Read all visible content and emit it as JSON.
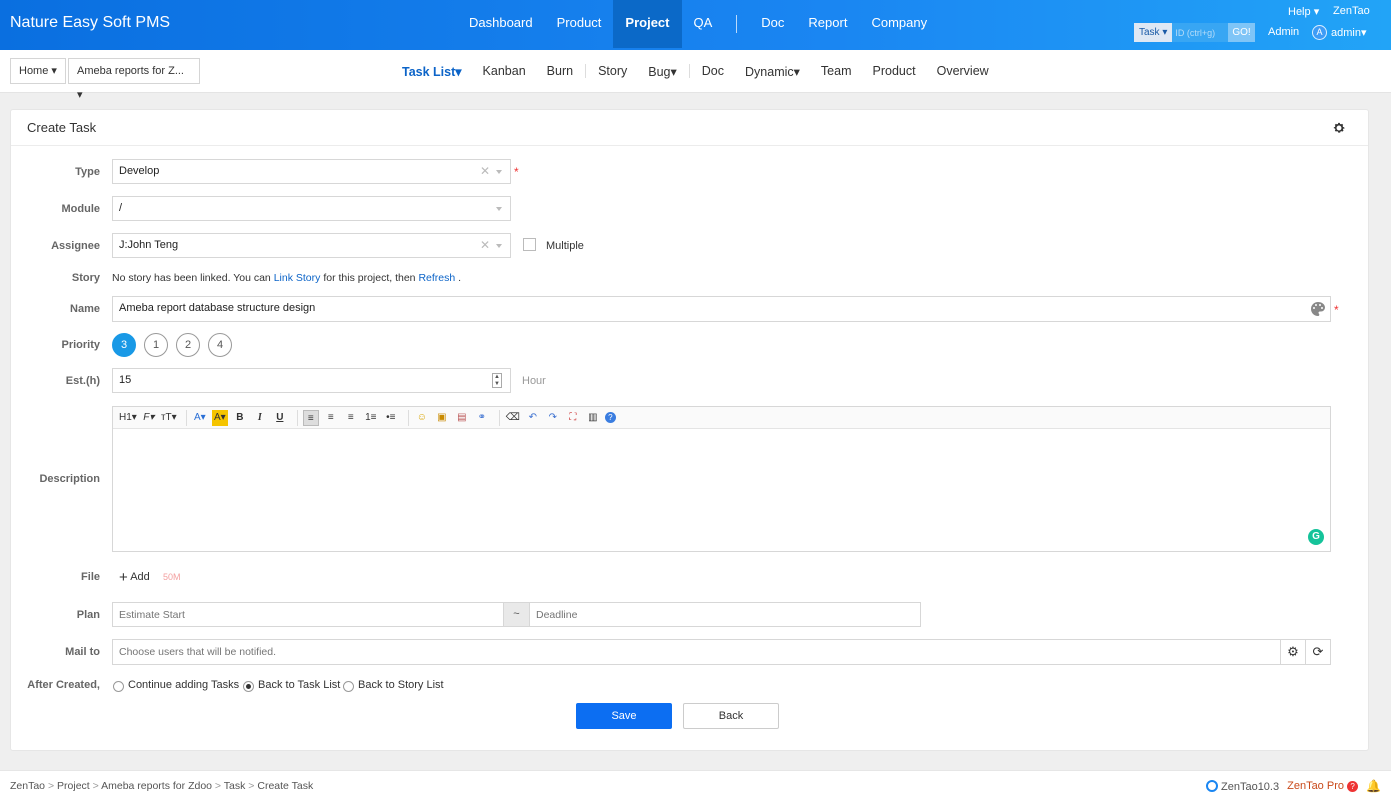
{
  "header": {
    "brand": "Nature Easy Soft PMS",
    "nav": [
      {
        "label": "Dashboard",
        "active": false
      },
      {
        "label": "Product",
        "active": false
      },
      {
        "label": "Project",
        "active": true
      },
      {
        "label": "QA",
        "active": false
      },
      {
        "label": "Doc",
        "active": false
      },
      {
        "label": "Report",
        "active": false
      },
      {
        "label": "Company",
        "active": false
      }
    ],
    "help": "Help",
    "zentao": "ZenTao",
    "search_type": "Task",
    "search_placeholder": "ID (ctrl+g)",
    "search_go": "GO!",
    "admin_label": "Admin",
    "avatar_letter": "A",
    "user": "admin"
  },
  "subheader": {
    "home": "Home",
    "project": "Ameba reports for Z...",
    "nav": [
      {
        "label": "Task List",
        "active": true,
        "dropdown": true
      },
      {
        "label": "Kanban"
      },
      {
        "label": "Burn"
      },
      {
        "label": "Story"
      },
      {
        "label": "Bug",
        "dropdown": true
      },
      {
        "label": "Doc"
      },
      {
        "label": "Dynamic",
        "dropdown": true
      },
      {
        "label": "Team"
      },
      {
        "label": "Product"
      },
      {
        "label": "Overview"
      }
    ]
  },
  "form": {
    "title": "Create Task",
    "labels": {
      "type": "Type",
      "module": "Module",
      "assignee": "Assignee",
      "story": "Story",
      "name": "Name",
      "priority": "Priority",
      "estimate": "Est.(h)",
      "description": "Description",
      "file": "File",
      "plan": "Plan",
      "mailto": "Mail to",
      "after_created": "After Created,"
    },
    "type_value": "Develop",
    "module_value": "/",
    "assignee_value": "J:John Teng",
    "multiple_label": "Multiple",
    "story_text_1": "No story has been linked. You can",
    "story_link": "Link Story",
    "story_text_2": "for this project, then",
    "story_refresh": "Refresh",
    "story_dot": ".",
    "name_value": "Ameba report database structure design",
    "priorities": [
      "3",
      "1",
      "2",
      "4"
    ],
    "priority_selected": "3",
    "estimate_value": "15",
    "estimate_unit": "Hour",
    "file_add": "Add",
    "file_limit": "50M",
    "plan_start_placeholder": "Estimate Start",
    "plan_sep": "~",
    "plan_deadline_placeholder": "Deadline",
    "mailto_placeholder": "Choose users that will be notified.",
    "after_options": [
      {
        "label": "Continue adding Tasks",
        "checked": false
      },
      {
        "label": "Back to Task List",
        "checked": true
      },
      {
        "label": "Back to Story List",
        "checked": false
      }
    ],
    "save": "Save",
    "back": "Back"
  },
  "editor_toolbar": [
    "H1",
    "F",
    "тT",
    "A",
    "A",
    "B",
    "I",
    "U",
    "≡",
    "≡",
    "≡",
    "1≡",
    "•≡",
    "☺",
    "▣",
    "▤",
    "⚭",
    "⌫",
    "↶",
    "↷",
    "⛶",
    "▥",
    "?"
  ],
  "footer": {
    "crumbs": [
      "ZenTao",
      "Project",
      "Ameba reports for Zdoo",
      "Task",
      "Create Task"
    ],
    "version": "ZenTao10.3",
    "pro": "ZenTao Pro"
  }
}
